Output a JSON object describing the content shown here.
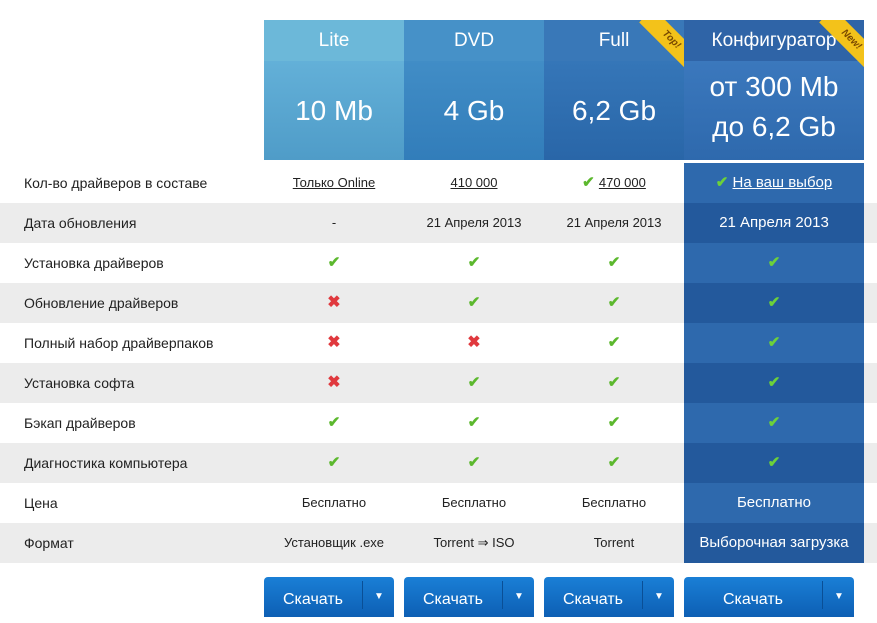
{
  "columns": [
    {
      "name": "Lite",
      "size_line1": "10 Mb",
      "size_line2": ""
    },
    {
      "name": "DVD",
      "size_line1": "4 Gb",
      "size_line2": ""
    },
    {
      "name": "Full",
      "size_line1": "6,2 Gb",
      "size_line2": "",
      "ribbon": "Top!"
    },
    {
      "name": "Конфигуратор",
      "size_line1": "от 300 Mb",
      "size_line2": "до 6,2 Gb",
      "ribbon": "New!"
    }
  ],
  "rows": [
    {
      "label": "Кол-во драйверов в составе",
      "values": [
        "Только Online",
        "410 000",
        "470 000",
        "На ваш выбор"
      ]
    },
    {
      "label": "Дата обновления",
      "values": [
        "-",
        "21 Апреля 2013",
        "21 Апреля 2013",
        "21 Апреля 2013"
      ]
    },
    {
      "label": "Установка драйверов",
      "values": [
        "check",
        "check",
        "check",
        "check"
      ]
    },
    {
      "label": "Обновление драйверов",
      "values": [
        "cross",
        "check",
        "check",
        "check"
      ]
    },
    {
      "label": "Полный набор драйверпаков",
      "values": [
        "cross",
        "cross",
        "check",
        "check"
      ]
    },
    {
      "label": "Установка софта",
      "values": [
        "cross",
        "check",
        "check",
        "check"
      ]
    },
    {
      "label": "Бэкап драйверов",
      "values": [
        "check",
        "check",
        "check",
        "check"
      ]
    },
    {
      "label": "Диагностика компьютера",
      "values": [
        "check",
        "check",
        "check",
        "check"
      ]
    },
    {
      "label": "Цена",
      "values": [
        "Бесплатно",
        "Бесплатно",
        "Бесплатно",
        "Бесплатно"
      ]
    },
    {
      "label": "Формат",
      "values": [
        "Установщик .exe",
        "Torrent ⇒ ISO",
        "Torrent",
        "Выборочная загрузка"
      ]
    }
  ],
  "buttons": {
    "download_label": "Скачать",
    "dropdown_glyph": "▼"
  },
  "icons": {
    "check": "check-icon",
    "cross": "cross-icon",
    "dropdown": "chevron-down-icon"
  },
  "colors": {
    "accent_blue": "#0d5fb4",
    "check_green": "#5cb82e",
    "cross_red": "#e0393e",
    "ribbon_yellow": "#f3c21a"
  }
}
